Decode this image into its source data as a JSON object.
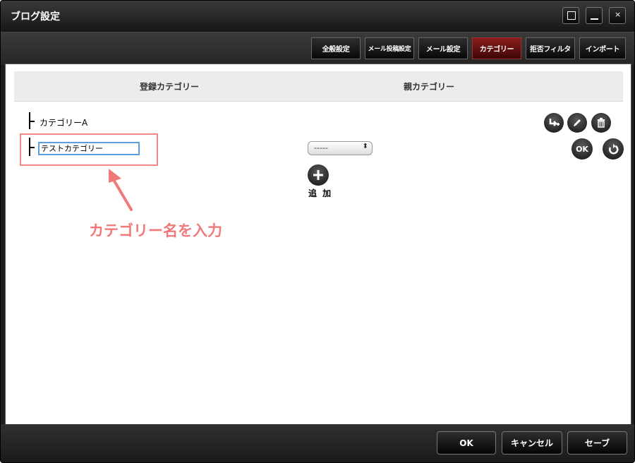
{
  "window": {
    "title": "ブログ設定"
  },
  "tabs": [
    {
      "label": "全般設定",
      "active": false
    },
    {
      "label": "メール投稿設定",
      "active": false
    },
    {
      "label": "メール設定",
      "active": false
    },
    {
      "label": "カテゴリー",
      "active": true
    },
    {
      "label": "拒否フィルタ",
      "active": false
    },
    {
      "label": "インポート",
      "active": false
    }
  ],
  "table": {
    "col_registered": "登録カテゴリー",
    "col_parent": "親カテゴリー"
  },
  "categories": [
    {
      "name": "カテゴリーA"
    }
  ],
  "new_category": {
    "value": "テストカテゴリー",
    "parent_selected": "-----"
  },
  "actions": {
    "add_label": "追 加",
    "ok_label": "OK"
  },
  "annotation": {
    "text": "カテゴリー名を入力",
    "color": "#f07a7a"
  },
  "footer": {
    "ok": "OK",
    "cancel": "キャンセル",
    "save": "セーブ"
  },
  "colors": {
    "active_tab": "#6a1010",
    "input_focus": "#5a9fe0"
  }
}
